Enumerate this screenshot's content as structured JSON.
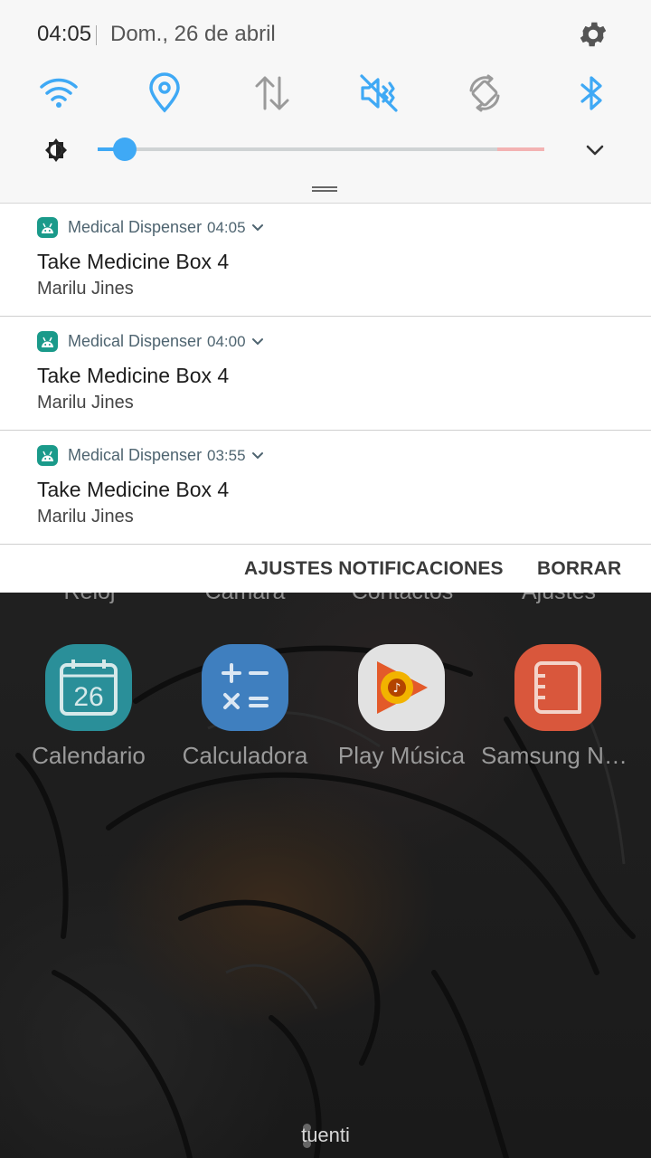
{
  "status": {
    "time": "04:05",
    "date": "Dom., 26 de abril"
  },
  "quick_settings": {
    "tiles": [
      {
        "icon": "wifi-icon",
        "active": true
      },
      {
        "icon": "location-icon",
        "active": true
      },
      {
        "icon": "mobile-data-icon",
        "active": false
      },
      {
        "icon": "mute-icon",
        "active": true
      },
      {
        "icon": "auto-rotate-icon",
        "active": false
      },
      {
        "icon": "bluetooth-icon",
        "active": true
      }
    ],
    "brightness_level": 0.06,
    "accent_color": "#3fa9f5"
  },
  "notifications": [
    {
      "app": "Medical Dispenser",
      "time": "04:05",
      "title": "Take Medicine Box 4",
      "text": "Marilu Jines"
    },
    {
      "app": "Medical Dispenser",
      "time": "04:00",
      "title": "Take Medicine Box 4",
      "text": "Marilu Jines"
    },
    {
      "app": "Medical Dispenser",
      "time": "03:55",
      "title": "Take Medicine Box 4",
      "text": "Marilu Jines"
    }
  ],
  "actions": {
    "settings_label": "AJUSTES NOTIFICACIONES",
    "clear_label": "BORRAR"
  },
  "home": {
    "top_labels": [
      "Reloj",
      "Cámara",
      "Contactos",
      "Ajustes"
    ],
    "apps": [
      {
        "label": "Calendario",
        "icon": "calendar-icon",
        "badge": "26",
        "color": "#2a8f99"
      },
      {
        "label": "Calculadora",
        "icon": "calculator-icon",
        "color": "#3f7fbf"
      },
      {
        "label": "Play Música",
        "icon": "play-music-icon",
        "color": "#e8e8e8"
      },
      {
        "label": "Samsung Not…",
        "icon": "notes-icon",
        "color": "#d9573c"
      }
    ],
    "carrier": "tuenti"
  }
}
